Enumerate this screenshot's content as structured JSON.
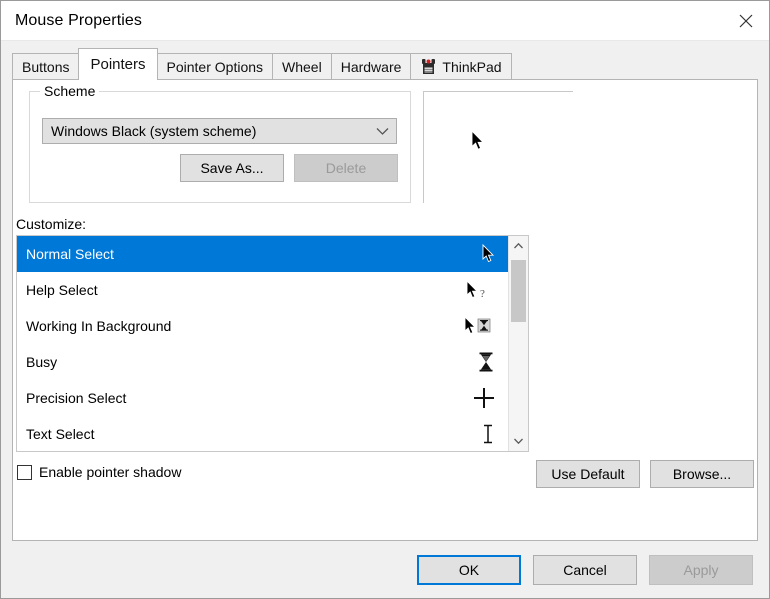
{
  "window": {
    "title": "Mouse Properties",
    "close_icon": "close-icon"
  },
  "tabs": [
    {
      "label": "Buttons",
      "selected": false,
      "icon": null
    },
    {
      "label": "Pointers",
      "selected": true,
      "icon": null
    },
    {
      "label": "Pointer Options",
      "selected": false,
      "icon": null
    },
    {
      "label": "Wheel",
      "selected": false,
      "icon": null
    },
    {
      "label": "Hardware",
      "selected": false,
      "icon": null
    },
    {
      "label": "ThinkPad",
      "selected": false,
      "icon": "thinkpad-icon"
    }
  ],
  "scheme": {
    "group_label": "Scheme",
    "selected_value": "Windows Black (system scheme)",
    "dropdown_icon": "chevron-down-icon",
    "save_as_label": "Save As...",
    "save_as_enabled": true,
    "delete_label": "Delete",
    "delete_enabled": false
  },
  "preview": {
    "cursor_icon": "arrow-cursor-icon"
  },
  "customize": {
    "label": "Customize:",
    "rows": [
      {
        "label": "Normal Select",
        "cursor": "arrow-cursor-icon",
        "selected": true
      },
      {
        "label": "Help Select",
        "cursor": "arrow-question-cursor-icon",
        "selected": false
      },
      {
        "label": "Working In Background",
        "cursor": "arrow-hourglass-cursor-icon",
        "selected": false
      },
      {
        "label": "Busy",
        "cursor": "hourglass-cursor-icon",
        "selected": false
      },
      {
        "label": "Precision Select",
        "cursor": "crosshair-cursor-icon",
        "selected": false
      },
      {
        "label": "Text Select",
        "cursor": "ibeam-cursor-icon",
        "selected": false
      }
    ],
    "scrollbar": {
      "up_icon": "chevron-up-icon",
      "down_icon": "chevron-down-icon"
    }
  },
  "options": {
    "shadow_label": "Enable pointer shadow",
    "shadow_checked": false,
    "use_default_label": "Use Default",
    "browse_label": "Browse..."
  },
  "dialog_buttons": {
    "ok_label": "OK",
    "cancel_label": "Cancel",
    "apply_label": "Apply",
    "apply_enabled": false
  },
  "colors": {
    "accent": "#0078d7",
    "dialog_bg": "#f0f0f0",
    "panel_bg": "#ffffff",
    "button_bg": "#e1e1e1",
    "disabled_text": "#9a9a9a"
  }
}
